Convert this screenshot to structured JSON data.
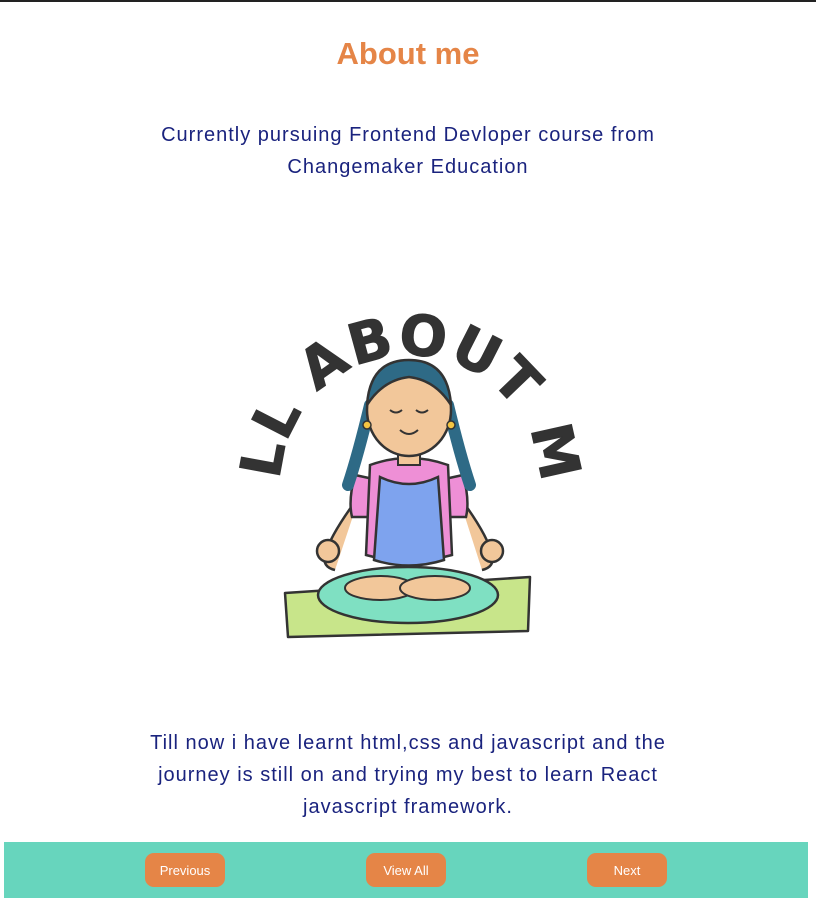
{
  "header": {
    "title": "About me"
  },
  "main": {
    "intro": "Currently pursuing Frontend Devloper course from Changemaker Education",
    "illustration": {
      "icon": "meditating-girl-illustration",
      "lettering": "ALL ABOUT ME"
    },
    "outro": "Till now i have learnt html,css and javascript and the journey is still on and trying my best to learn React javascript framework."
  },
  "footer": {
    "previous_label": "Previous",
    "view_all_label": "View All",
    "next_label": "Next"
  },
  "colors": {
    "accent": "#e58547",
    "text": "#1a237e",
    "footer_bg": "#67d5bd"
  }
}
